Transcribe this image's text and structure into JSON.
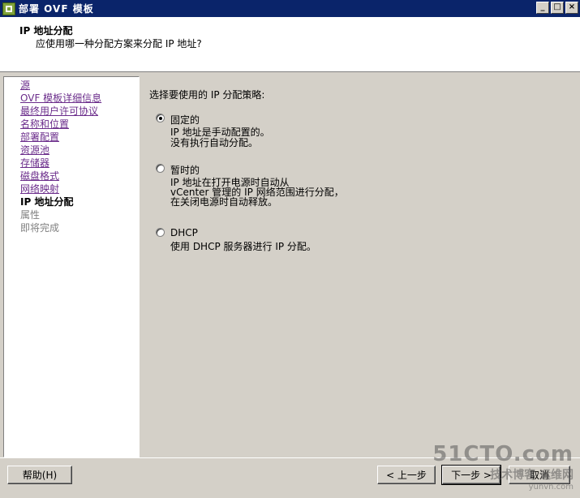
{
  "window": {
    "title": "部署 OVF 模板",
    "buttons": [
      "_",
      "□",
      "×"
    ]
  },
  "header": {
    "title": "IP 地址分配",
    "subtitle": "应使用哪一种分配方案来分配 IP 地址?"
  },
  "sidebar": {
    "items": [
      {
        "label": "源",
        "state": "link"
      },
      {
        "label": "OVF 模板详细信息",
        "state": "link"
      },
      {
        "label": "最终用户许可协议",
        "state": "link"
      },
      {
        "label": "名称和位置",
        "state": "link"
      },
      {
        "label": "部署配置",
        "state": "link"
      },
      {
        "label": "资源池",
        "state": "link"
      },
      {
        "label": "存储器",
        "state": "link"
      },
      {
        "label": "磁盘格式",
        "state": "link"
      },
      {
        "label": "网络映射",
        "state": "link"
      },
      {
        "label": "IP 地址分配",
        "state": "current"
      },
      {
        "label": "属性",
        "state": "disabled"
      },
      {
        "label": "即将完成",
        "state": "disabled"
      }
    ]
  },
  "main": {
    "prompt": "选择要使用的 IP 分配策略:",
    "options": [
      {
        "label": "固定的",
        "checked": true,
        "desc": [
          "IP 地址是手动配置的。",
          "没有执行自动分配。"
        ]
      },
      {
        "label": "暂时的",
        "checked": false,
        "desc": [
          "IP 地址在打开电源时自动从",
          "vCenter 管理的 IP 网络范围进行分配，",
          "在关闭电源时自动释放。"
        ]
      },
      {
        "label": "DHCP",
        "checked": false,
        "desc": [
          "使用 DHCP 服务器进行 IP 分配。"
        ]
      }
    ]
  },
  "footer": {
    "help": "帮助(H)",
    "back": "< 上一步",
    "next": "下一步 >",
    "cancel": "取消"
  },
  "watermark": {
    "line1": "51CTO.com",
    "line2": "技术博客 运维网",
    "line3": "yunvn.com"
  }
}
